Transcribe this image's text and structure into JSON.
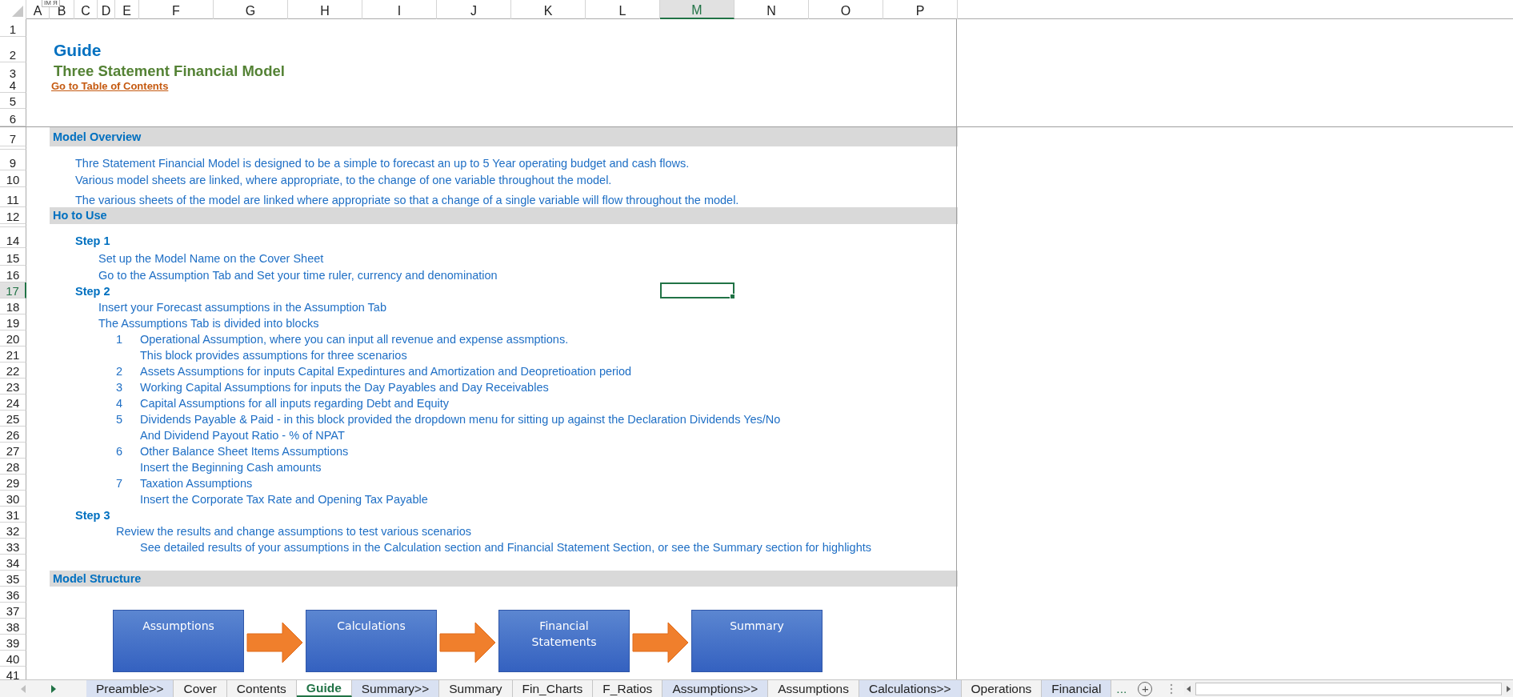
{
  "name_box_tooltip": "IM Я",
  "columns": [
    {
      "label": "A",
      "selected": false
    },
    {
      "label": "B",
      "selected": false
    },
    {
      "label": "C",
      "selected": false
    },
    {
      "label": "D",
      "selected": false
    },
    {
      "label": "E",
      "selected": false
    },
    {
      "label": "F",
      "selected": false
    },
    {
      "label": "G",
      "selected": false
    },
    {
      "label": "H",
      "selected": false
    },
    {
      "label": "I",
      "selected": false
    },
    {
      "label": "J",
      "selected": false
    },
    {
      "label": "K",
      "selected": false
    },
    {
      "label": "L",
      "selected": false
    },
    {
      "label": "M",
      "selected": true
    },
    {
      "label": "N",
      "selected": false
    },
    {
      "label": "O",
      "selected": false
    },
    {
      "label": "P",
      "selected": false
    }
  ],
  "rows": [
    {
      "label": "1",
      "selected": false
    },
    {
      "label": "2",
      "selected": false,
      "kind": "title",
      "cells": {
        "B": "Guide"
      }
    },
    {
      "label": "3",
      "selected": false,
      "kind": "subtitle",
      "cells": {
        "B": "Three Statement Financial Model"
      }
    },
    {
      "label": "4",
      "selected": false,
      "kind": "link",
      "cells": {
        "B": "Go to Table of Contents"
      }
    },
    {
      "label": "5",
      "selected": false
    },
    {
      "label": "6",
      "selected": false
    },
    {
      "label": "7",
      "selected": false,
      "kind": "section",
      "cells": {
        "B": "Model Overview"
      }
    },
    {
      "selected": false
    },
    {
      "label": "9",
      "selected": false,
      "kind": "text",
      "cells": {
        "C": "Thre Statement Financial Model is designed to be a simple to forecast an up to 5 Year operating budget and cash flows."
      }
    },
    {
      "label": "10",
      "selected": false,
      "kind": "text",
      "cells": {
        "C": "Various model sheets are linked, where appropriate, to the change of one variable throughout the model."
      }
    },
    {
      "label": "11",
      "selected": false,
      "kind": "text",
      "cells": {
        "C": "The various sheets of the model are linked where appropriate so that a change of a single variable will flow throughout the model."
      }
    },
    {
      "label": "12",
      "selected": false,
      "kind": "section",
      "cells": {
        "B": "Ho to Use"
      }
    },
    {
      "selected": false
    },
    {
      "label": "14",
      "selected": false,
      "kind": "step",
      "cells": {
        "C": "Step 1"
      }
    },
    {
      "label": "15",
      "selected": false,
      "kind": "text",
      "cells": {
        "D": "Set up the Model Name on the Cover Sheet"
      }
    },
    {
      "label": "16",
      "selected": false,
      "kind": "text",
      "cells": {
        "D": "Go to the Assumption Tab and Set your time ruler, currency and denomination"
      }
    },
    {
      "label": "17",
      "selected": true,
      "kind": "step",
      "cells": {
        "C": "Step 2"
      }
    },
    {
      "label": "18",
      "selected": false,
      "kind": "text",
      "cells": {
        "D": "Insert your Forecast assumptions in the Assumption Tab"
      }
    },
    {
      "label": "19",
      "selected": false,
      "kind": "text",
      "cells": {
        "D": "The Assumptions Tab is divided into blocks"
      }
    },
    {
      "label": "20",
      "selected": false,
      "kind": "text",
      "cells": {
        "E": "1",
        "F": "Operational Assumption, where you can input all revenue and expense assmptions."
      }
    },
    {
      "label": "21",
      "selected": false,
      "kind": "text",
      "cells": {
        "F": "This block provides assumptions for three scenarios"
      }
    },
    {
      "label": "22",
      "selected": false,
      "kind": "text",
      "cells": {
        "E": "2",
        "F": "Assets Assumptions for inputs Capital Expedintures and Amortization and Deopretioation period"
      }
    },
    {
      "label": "23",
      "selected": false,
      "kind": "text",
      "cells": {
        "E": "3",
        "F": "Working Capital Assumptions for inputs the Day Payables and Day Receivables"
      }
    },
    {
      "label": "24",
      "selected": false,
      "kind": "text",
      "cells": {
        "E": "4",
        "F": "Capital  Assumptions for all inputs regarding Debt and Equity"
      }
    },
    {
      "label": "25",
      "selected": false,
      "kind": "text",
      "cells": {
        "E": "5",
        "F": "Dividends Payable & Paid - in this block provided the dropdown menu for sitting up against the Declaration Dividends Yes/No"
      }
    },
    {
      "label": "26",
      "selected": false,
      "kind": "text",
      "cells": {
        "F": "And Dividend Payout Ratio - % of NPAT"
      }
    },
    {
      "label": "27",
      "selected": false,
      "kind": "text",
      "cells": {
        "E": "6",
        "F": "Other Balance Sheet Items  Assumptions"
      }
    },
    {
      "label": "28",
      "selected": false,
      "kind": "text",
      "cells": {
        "F": "Insert the Beginning Cash amounts"
      }
    },
    {
      "label": "29",
      "selected": false,
      "kind": "text",
      "cells": {
        "E": "7",
        "F": "Taxation  Assumptions"
      }
    },
    {
      "label": "30",
      "selected": false,
      "kind": "text",
      "cells": {
        "F": "Insert the Corporate Tax Rate and Opening Tax Payable"
      }
    },
    {
      "label": "31",
      "selected": false,
      "kind": "step",
      "cells": {
        "C": "Step 3"
      }
    },
    {
      "label": "32",
      "selected": false,
      "kind": "text",
      "cells": {
        "E": "Review the results and change assumptions to test various scenarios"
      }
    },
    {
      "label": "33",
      "selected": false,
      "kind": "text",
      "cells": {
        "F": "See detailed results of your assumptions in the Calculation  section and Financial Statement Section, or see the Summary section for highlights"
      }
    },
    {
      "label": "34",
      "selected": false
    },
    {
      "label": "35",
      "selected": false,
      "kind": "section",
      "cells": {
        "B": "Model Structure"
      }
    },
    {
      "label": "36",
      "selected": false
    },
    {
      "label": "37",
      "selected": false
    },
    {
      "label": "38",
      "selected": false
    },
    {
      "label": "39",
      "selected": false
    },
    {
      "label": "40",
      "selected": false
    },
    {
      "label": "41",
      "selected": false
    }
  ],
  "model_structure_diagram": {
    "boxes": [
      "Assumptions",
      "Calculations",
      "Financial Statements",
      "Summary"
    ]
  },
  "sheet_tabs": [
    {
      "label": "Preamble>>",
      "selected": false,
      "color": "#d9e1f2"
    },
    {
      "label": "Cover",
      "selected": false
    },
    {
      "label": "Contents",
      "selected": false
    },
    {
      "label": "Guide",
      "selected": true
    },
    {
      "label": "Summary>>",
      "selected": false,
      "color": "#d9e1f2"
    },
    {
      "label": "Summary",
      "selected": false
    },
    {
      "label": "Fin_Charts",
      "selected": false
    },
    {
      "label": "F_Ratios",
      "selected": false
    },
    {
      "label": "Assumptions>>",
      "selected": false,
      "color": "#d9e1f2"
    },
    {
      "label": "Assumptions",
      "selected": false
    },
    {
      "label": "Calculations>>",
      "selected": false,
      "color": "#d9e1f2"
    },
    {
      "label": "Operations",
      "selected": false
    },
    {
      "label": "Financial",
      "selected": false,
      "color": "#d9e1f2"
    }
  ],
  "more_tabs": "...",
  "add_sheet": "+"
}
